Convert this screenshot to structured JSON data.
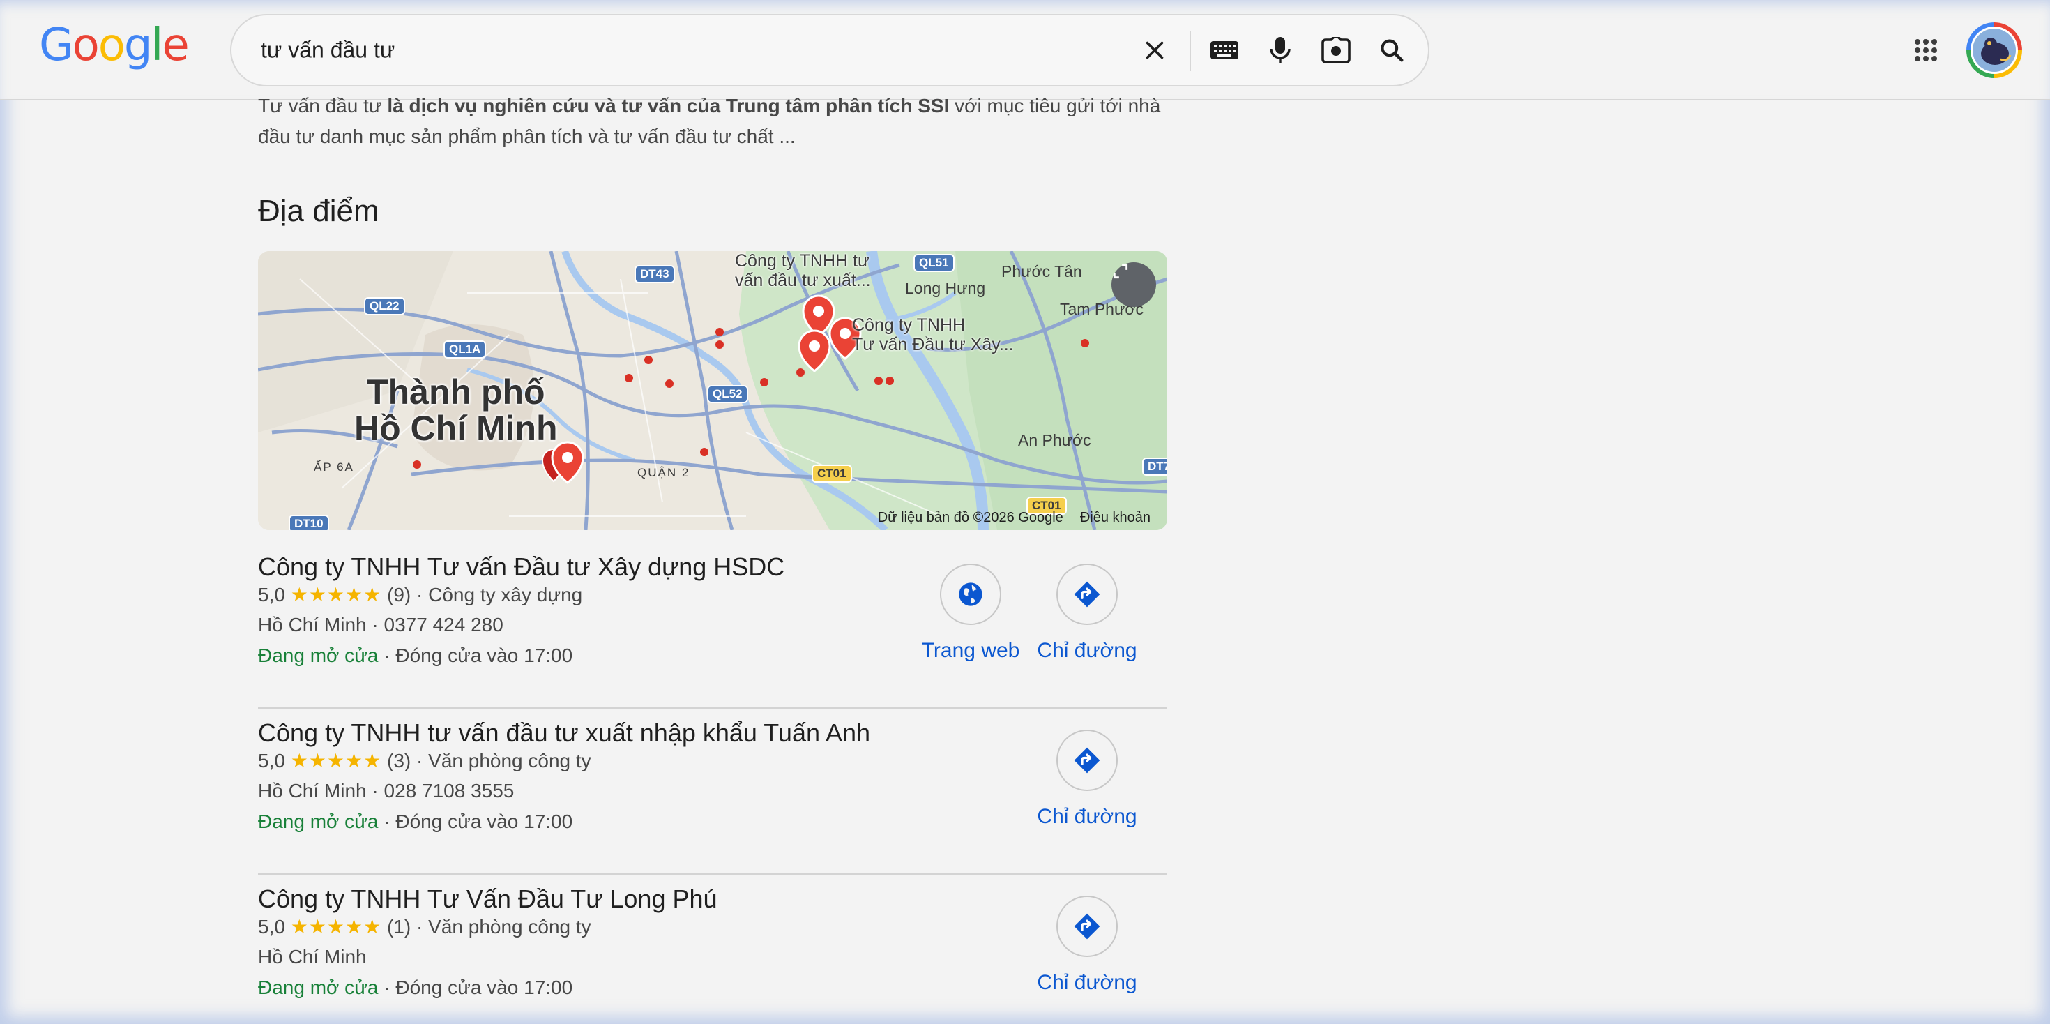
{
  "header": {
    "logo_letters": [
      {
        "ch": "G",
        "color": "#4285f4"
      },
      {
        "ch": "o",
        "color": "#ea4335"
      },
      {
        "ch": "o",
        "color": "#fbbc05"
      },
      {
        "ch": "g",
        "color": "#4285f4"
      },
      {
        "ch": "l",
        "color": "#34a853"
      },
      {
        "ch": "e",
        "color": "#ea4335"
      }
    ],
    "search_query": "tư vấn đầu tư",
    "icons": [
      "close-icon",
      "keyboard-icon",
      "microphone-icon",
      "camera-search-icon",
      "search-icon",
      "apps-grid-icon",
      "avatar"
    ]
  },
  "snippet": {
    "part1": "Tư vấn đầu tư ",
    "bold": "là dịch vụ nghiên cứu và tư vấn của Trung tâm phân tích SSI",
    "part2": " với mục tiêu gửi tới nhà đầu tư danh mục sản phẩm phân tích và tư vấn đầu tư chất ..."
  },
  "places": {
    "title": "Địa điểm",
    "map": {
      "city_line1": "Thành phố",
      "city_line2": "Hồ Chí Minh",
      "poi_1_line1": "Công ty TNHH tư",
      "poi_1_line2": "vấn đầu tư xuất...",
      "poi_2_line1": "Công ty TNHH",
      "poi_2_line2": "Tư vấn Đầu tư Xây...",
      "place_labels": [
        "Long Hưng",
        "Phước Tân",
        "Tam Phước",
        "An Phước",
        "ẤP 6A",
        "QUẬN 2"
      ],
      "road_tags": [
        "QL22",
        "QL1A",
        "DT43",
        "QL52",
        "QL51",
        "CT01",
        "CT01",
        "DT10",
        "DT7"
      ],
      "attribution": "Dữ liệu bản đồ ©2026 Google",
      "terms": "Điều khoản"
    },
    "results": [
      {
        "name": "Công ty TNHH Tư vấn Đầu tư Xây dựng HSDC",
        "rating": "5,0",
        "stars": "★★★★★",
        "reviews": "(9)",
        "category": "Công ty xây dựng",
        "location": "Hồ Chí Minh",
        "phone": "0377 424 280",
        "status": "Đang mở cửa",
        "hours": "Đóng cửa vào 17:00",
        "website_label": "Trang web",
        "directions_label": "Chỉ đường"
      },
      {
        "name": "Công ty TNHH tư vấn đầu tư xuất nhập khẩu Tuấn Anh",
        "rating": "5,0",
        "stars": "★★★★★",
        "reviews": "(3)",
        "category": "Văn phòng công ty",
        "location": "Hồ Chí Minh",
        "phone": "028 7108 3555",
        "status": "Đang mở cửa",
        "hours": "Đóng cửa vào 17:00",
        "directions_label": "Chỉ đường"
      },
      {
        "name": "Công ty TNHH Tư Vấn Đầu Tư Long Phú",
        "rating": "5,0",
        "stars": "★★★★★",
        "reviews": "(1)",
        "category": "Văn phòng công ty",
        "location": "Hồ Chí Minh",
        "status": "Đang mở cửa",
        "hours": "Đóng cửa vào 17:00",
        "directions_label": "Chỉ đường"
      }
    ]
  },
  "colors": {
    "link_blue": "#0b57d0",
    "open_green": "#188038",
    "star_yellow": "#f5b400",
    "pin_red": "#ea4335"
  }
}
